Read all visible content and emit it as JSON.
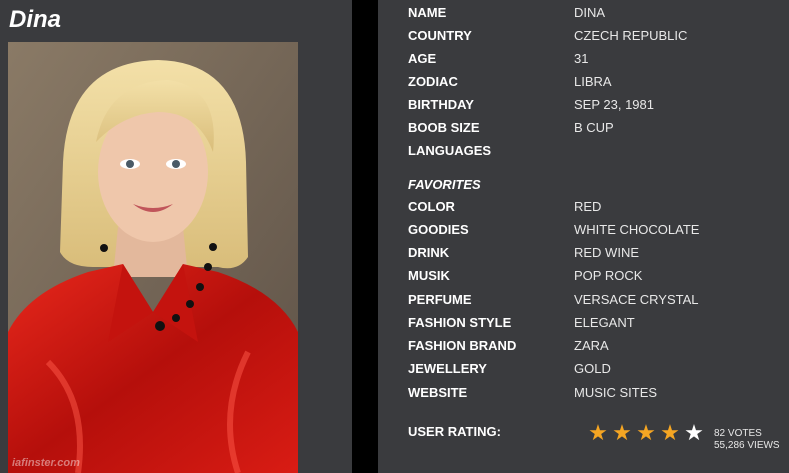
{
  "profile": {
    "name": "Dina"
  },
  "details": [
    {
      "label": "NAME",
      "value": "DINA"
    },
    {
      "label": "COUNTRY",
      "value": "CZECH REPUBLIC"
    },
    {
      "label": "AGE",
      "value": "31"
    },
    {
      "label": "ZODIAC",
      "value": "LIBRA"
    },
    {
      "label": "BIRTHDAY",
      "value": "SEP 23, 1981"
    },
    {
      "label": "BOOB SIZE",
      "value": "B CUP"
    },
    {
      "label": "LANGUAGES",
      "value": ""
    }
  ],
  "favorites": {
    "heading": "FAVORITES",
    "items": [
      {
        "label": "COLOR",
        "value": "RED"
      },
      {
        "label": "GOODIES",
        "value": "WHITE CHOCOLATE"
      },
      {
        "label": "DRINK",
        "value": "RED WINE"
      },
      {
        "label": "MUSIK",
        "value": "POP ROCK"
      },
      {
        "label": "PERFUME",
        "value": "VERSACE CRYSTAL"
      },
      {
        "label": "FASHION STYLE",
        "value": "ELEGANT"
      },
      {
        "label": "FASHION BRAND",
        "value": "ZARA"
      },
      {
        "label": "JEWELLERY",
        "value": "GOLD"
      },
      {
        "label": "WEBSITE",
        "value": "MUSIC SITES"
      }
    ]
  },
  "rating": {
    "label": "USER RATING:",
    "stars_filled": 4,
    "stars_total": 5,
    "votes": "82 VOTES",
    "views": "55,286 VIEWS",
    "star_color": "#f5a623"
  },
  "photo": {
    "watermark": "iafinster.com"
  }
}
